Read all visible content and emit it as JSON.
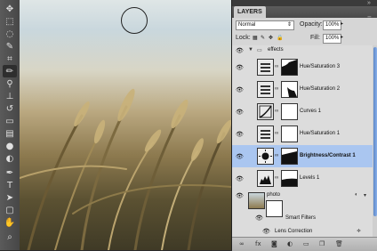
{
  "toolbar": {
    "tools": [
      "move-tool-icon",
      "marquee-tool-icon",
      "lasso-tool-icon",
      "quick-selection-icon",
      "crop-tool-icon",
      "eyedropper-icon",
      "healing-brush-icon",
      "brush-tool-icon",
      "clone-stamp-icon",
      "history-brush-icon",
      "eraser-icon",
      "gradient-icon",
      "blur-icon",
      "dodge-icon",
      "pen-tool-icon",
      "type-tool-icon",
      "path-selection-icon",
      "shape-tool-icon",
      "hand-tool-icon",
      "zoom-tool-icon"
    ],
    "active_index": 7
  },
  "panel": {
    "tab": "LAYERS",
    "blend_mode": "Normal",
    "opacity_label": "Opacity:",
    "opacity_value": "100%",
    "lock_label": "Lock:",
    "fill_label": "Fill:",
    "fill_value": "100%",
    "scroll_position": 0.05
  },
  "layers": [
    {
      "name": "effects",
      "type": "group",
      "selected": false
    },
    {
      "name": "Hue/Saturation 3",
      "type": "adjustment",
      "selected": false
    },
    {
      "name": "Hue/Saturation 2",
      "type": "adjustment",
      "selected": false
    },
    {
      "name": "Curves 1",
      "type": "adjustment",
      "selected": false
    },
    {
      "name": "Hue/Saturation 1",
      "type": "adjustment",
      "selected": false
    },
    {
      "name": "Brightness/Contrast 1",
      "type": "adjustment",
      "selected": true
    },
    {
      "name": "Levels 1",
      "type": "adjustment",
      "selected": false
    },
    {
      "name": "photo",
      "type": "smart-object",
      "selected": false
    },
    {
      "name": "Smart Filters",
      "type": "smart-filters",
      "selected": false
    },
    {
      "name": "Lens Correction",
      "type": "filter",
      "selected": false
    }
  ],
  "colors": {
    "selection": "#aac6f0",
    "scrollbar": "#6f98d8",
    "panel_bg": "#d6d6d6"
  }
}
